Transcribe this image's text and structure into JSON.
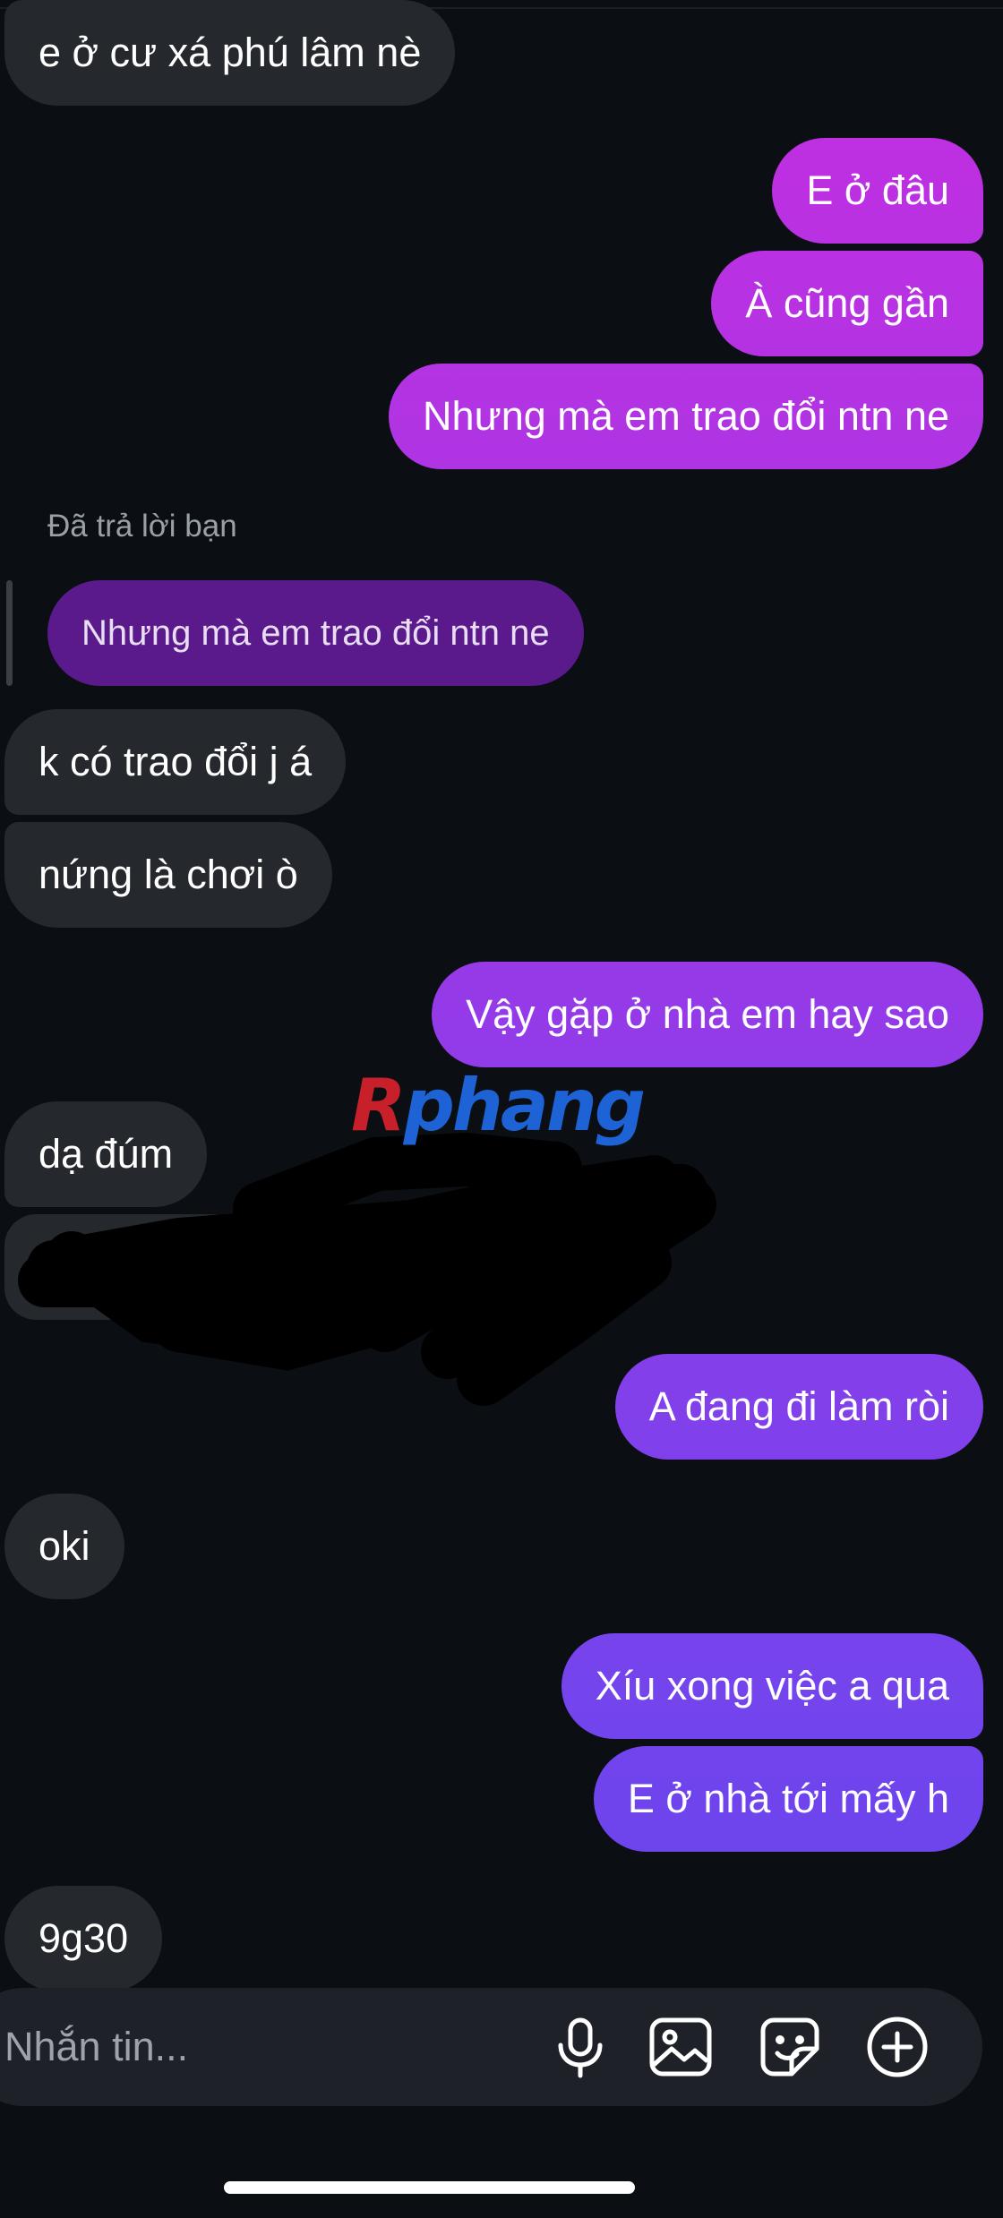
{
  "messages": [
    {
      "side": "in",
      "text": "e ở cư xá phú lâm nè"
    },
    {
      "side": "out",
      "text": "E ở đâu"
    },
    {
      "side": "out",
      "text": "À cũng gần"
    },
    {
      "side": "out",
      "text": "Nhưng mà em trao đổi ntn ne"
    },
    {
      "side": "in",
      "text": "k có trao đổi j á"
    },
    {
      "side": "in",
      "text": "nứng là chơi ò"
    },
    {
      "side": "out",
      "text": "Vậy gặp ở nhà em hay sao"
    },
    {
      "side": "in",
      "text": "dạ đúm"
    },
    {
      "side": "out",
      "text": "A đang đi làm ròi"
    },
    {
      "side": "in",
      "text": "oki"
    },
    {
      "side": "out",
      "text": "Xíu xong việc a qua"
    },
    {
      "side": "out",
      "text": "E ở nhà tới mấy h"
    },
    {
      "side": "in",
      "text": "9g30"
    }
  ],
  "reply": {
    "label": "Đã trả lời bạn",
    "quoted_text": "Nhưng mà em trao đổi ntn ne"
  },
  "watermark": {
    "part1": "R",
    "part2": "phang"
  },
  "composer": {
    "placeholder": "Nhắn tin...",
    "icons": [
      "microphone-icon",
      "image-icon",
      "sticker-icon",
      "plus-circle-icon"
    ]
  },
  "colors": {
    "background": "#0b0f14",
    "incoming_bubble": "#25282d",
    "outgoing_gradient_top": "#c52ee0",
    "outgoing_gradient_bottom": "#5b4af0",
    "reply_bubble": "#5a1a8c"
  }
}
